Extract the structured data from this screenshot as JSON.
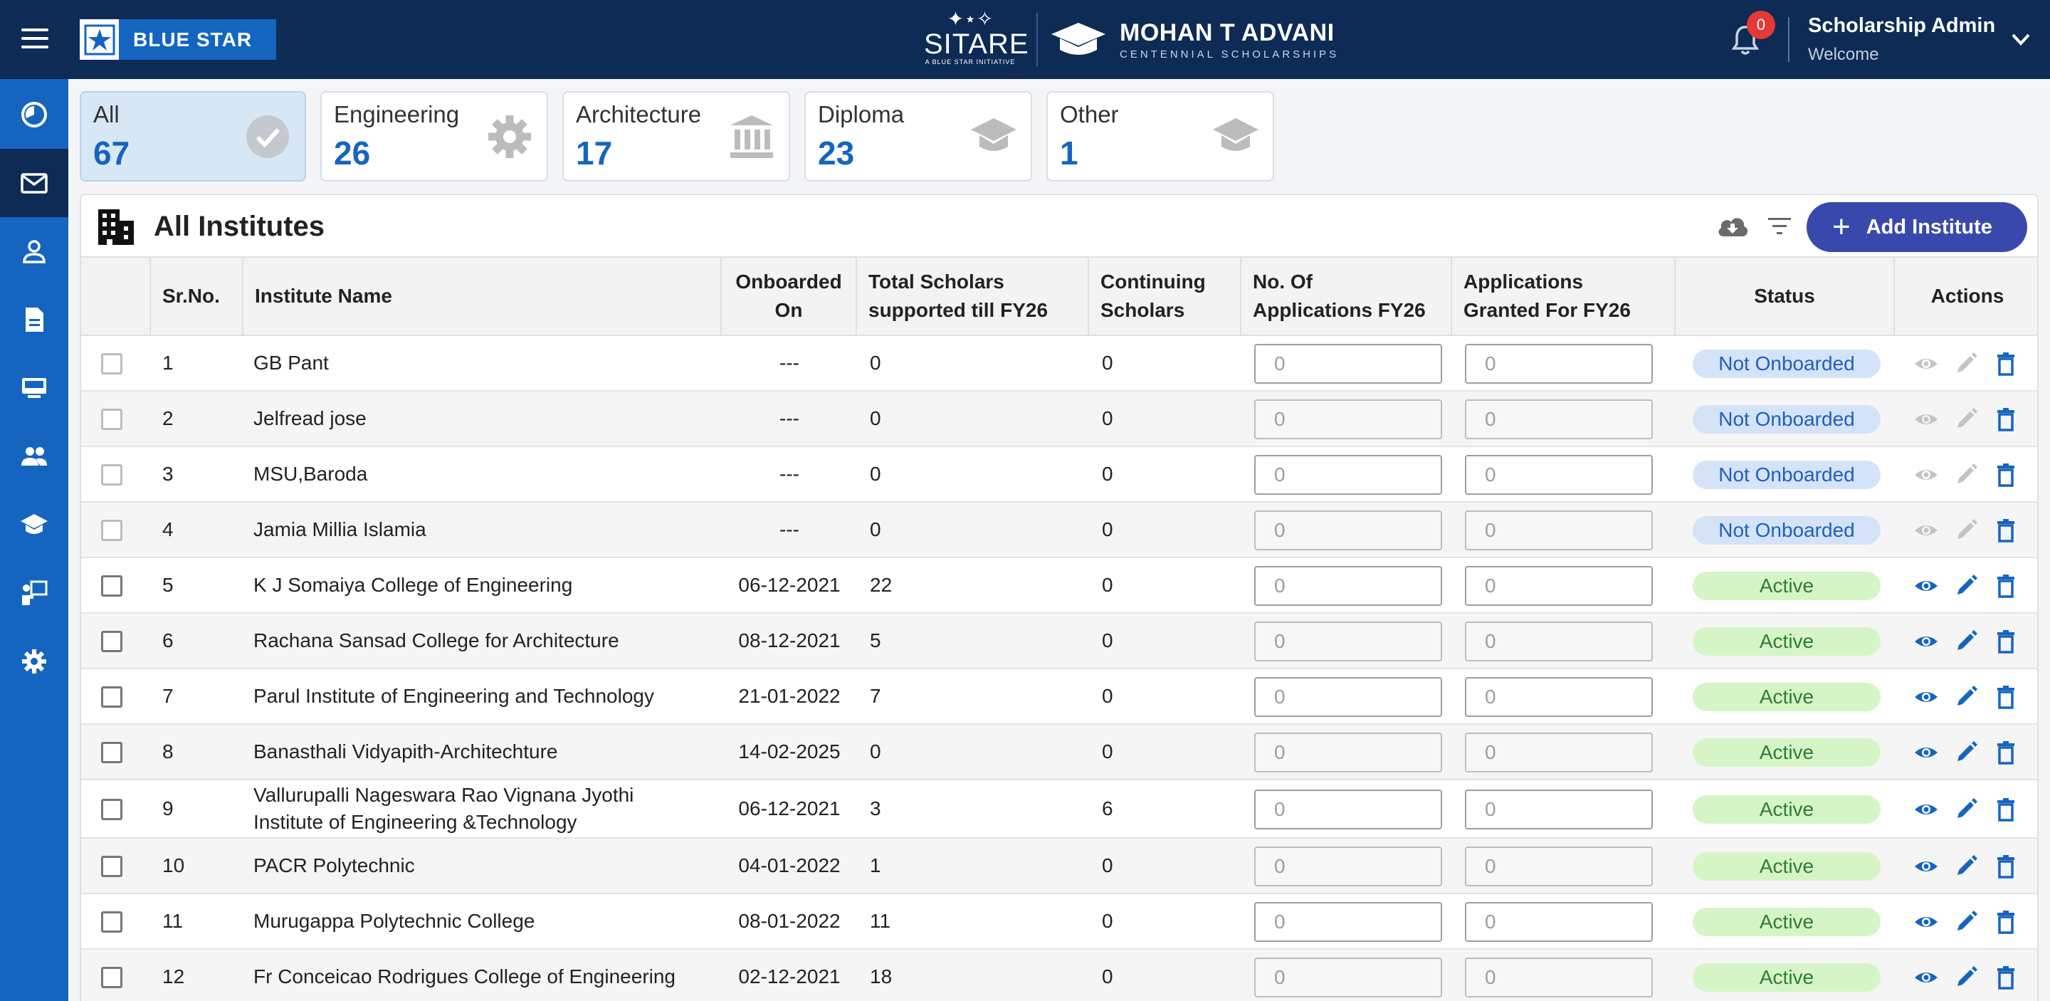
{
  "header": {
    "brand": "BLUE STAR",
    "sitare_name": "SITARE",
    "sitare_sub": "A BLUE STAR INITIATIVE",
    "program_title": "MOHAN T ADVANI",
    "program_sub": "CENTENNIAL SCHOLARSHIPS",
    "notification_count": "0",
    "user_name": "Scholarship Admin",
    "user_greeting": "Welcome"
  },
  "sidebar": {
    "items": [
      {
        "icon": "dashboard-icon",
        "active": false
      },
      {
        "icon": "mail-icon",
        "active": true
      },
      {
        "icon": "person-icon",
        "active": false
      },
      {
        "icon": "document-icon",
        "active": false
      },
      {
        "icon": "desktop-icon",
        "active": false
      },
      {
        "icon": "people-icon",
        "active": false
      },
      {
        "icon": "graduation-icon",
        "active": false
      },
      {
        "icon": "teacher-icon",
        "active": false
      },
      {
        "icon": "settings-icon",
        "active": false
      }
    ]
  },
  "categories": [
    {
      "label": "All",
      "count": "67",
      "icon": "check-circle-icon",
      "active": true
    },
    {
      "label": "Engineering",
      "count": "26",
      "icon": "gear-icon",
      "active": false
    },
    {
      "label": "Architecture",
      "count": "17",
      "icon": "institution-icon",
      "active": false
    },
    {
      "label": "Diploma",
      "count": "23",
      "icon": "graduation-cap-icon",
      "active": false
    },
    {
      "label": "Other",
      "count": "1",
      "icon": "graduation-cap-icon",
      "active": false
    }
  ],
  "panel": {
    "title": "All Institutes",
    "add_label": "Add Institute"
  },
  "table": {
    "headers": {
      "sr": "Sr.No.",
      "name": "Institute Name",
      "onboarded_1": "Onboarded",
      "onboarded_2": "On",
      "total_1": "Total Scholars",
      "total_2": "supported till FY26",
      "continuing_1": "Continuing",
      "continuing_2": "Scholars",
      "apps_1": "No. Of",
      "apps_2": "Applications FY26",
      "granted_1": "Applications",
      "granted_2": "Granted For FY26",
      "status": "Status",
      "actions": "Actions"
    },
    "rows": [
      {
        "sr": "1",
        "name": "GB Pant",
        "name2": "",
        "onboarded": "---",
        "total": "0",
        "continuing": "0",
        "apps": "0",
        "granted": "0",
        "status": "Not Onboarded"
      },
      {
        "sr": "2",
        "name": "Jelfread jose",
        "name2": "",
        "onboarded": "---",
        "total": "0",
        "continuing": "0",
        "apps": "0",
        "granted": "0",
        "status": "Not Onboarded"
      },
      {
        "sr": "3",
        "name": "MSU,Baroda",
        "name2": "",
        "onboarded": "---",
        "total": "0",
        "continuing": "0",
        "apps": "0",
        "granted": "0",
        "status": "Not Onboarded"
      },
      {
        "sr": "4",
        "name": "Jamia Millia Islamia",
        "name2": "",
        "onboarded": "---",
        "total": "0",
        "continuing": "0",
        "apps": "0",
        "granted": "0",
        "status": "Not Onboarded"
      },
      {
        "sr": "5",
        "name": "K J Somaiya College of Engineering",
        "name2": "",
        "onboarded": "06-12-2021",
        "total": "22",
        "continuing": "0",
        "apps": "0",
        "granted": "0",
        "status": "Active"
      },
      {
        "sr": "6",
        "name": "Rachana Sansad College for Architecture",
        "name2": "",
        "onboarded": "08-12-2021",
        "total": "5",
        "continuing": "0",
        "apps": "0",
        "granted": "0",
        "status": "Active"
      },
      {
        "sr": "7",
        "name": "Parul Institute of Engineering and Technology",
        "name2": "",
        "onboarded": "21-01-2022",
        "total": "7",
        "continuing": "0",
        "apps": "0",
        "granted": "0",
        "status": "Active"
      },
      {
        "sr": "8",
        "name": "Banasthali Vidyapith-Architechture",
        "name2": "",
        "onboarded": "14-02-2025",
        "total": "0",
        "continuing": "0",
        "apps": "0",
        "granted": "0",
        "status": "Active"
      },
      {
        "sr": "9",
        "name": "Vallurupalli Nageswara Rao Vignana Jyothi",
        "name2": "Institute of Engineering &Technology",
        "onboarded": "06-12-2021",
        "total": "3",
        "continuing": "6",
        "apps": "0",
        "granted": "0",
        "status": "Active"
      },
      {
        "sr": "10",
        "name": "PACR Polytechnic",
        "name2": "",
        "onboarded": "04-01-2022",
        "total": "1",
        "continuing": "0",
        "apps": "0",
        "granted": "0",
        "status": "Active"
      },
      {
        "sr": "11",
        "name": "Murugappa Polytechnic College",
        "name2": "",
        "onboarded": "08-01-2022",
        "total": "11",
        "continuing": "0",
        "apps": "0",
        "granted": "0",
        "status": "Active"
      },
      {
        "sr": "12",
        "name": "Fr Conceicao Rodrigues College of Engineering",
        "name2": "",
        "onboarded": "02-12-2021",
        "total": "18",
        "continuing": "0",
        "apps": "0",
        "granted": "0",
        "status": "Active"
      }
    ]
  },
  "colors": {
    "header_bg": "#0d2b55",
    "sidebar_bg": "#1565c0",
    "accent": "#3949ab",
    "active_status_bg": "#d5f5c6",
    "not_onboarded_bg": "#d4e3f8"
  }
}
